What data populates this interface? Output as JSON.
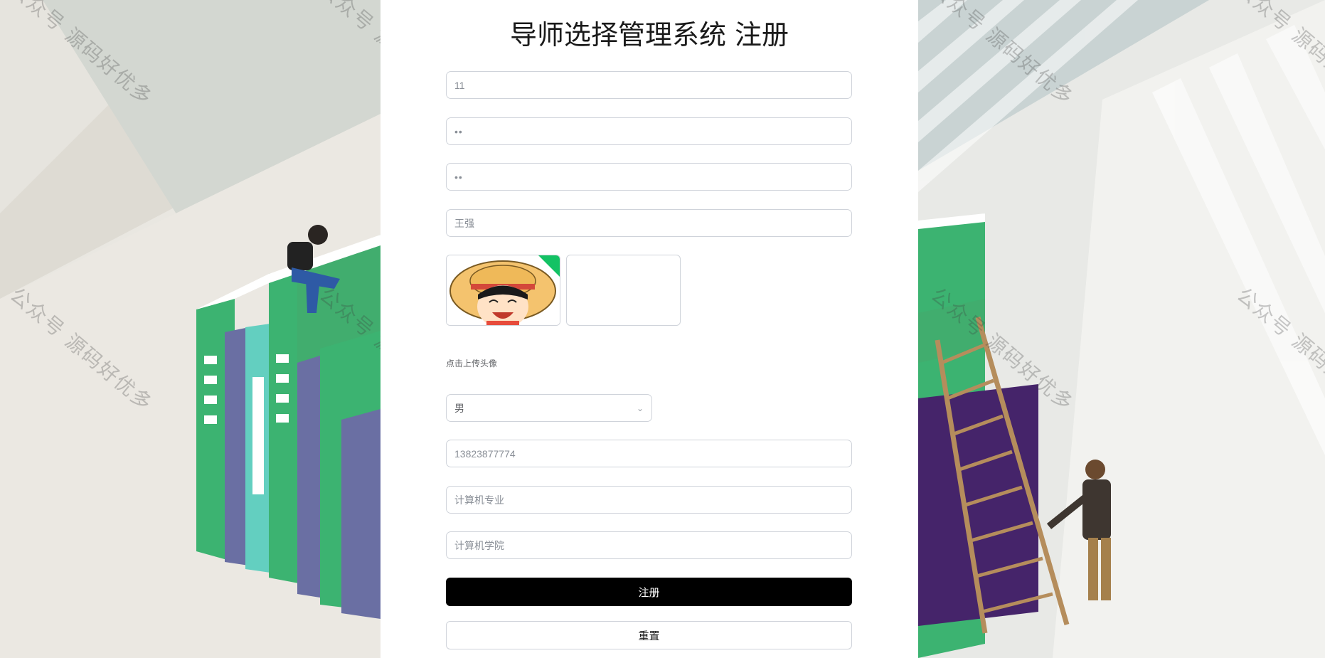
{
  "page": {
    "title": "导师选择管理系统 注册"
  },
  "form": {
    "account": "11",
    "password": "••",
    "password_confirm": "••",
    "name": "王强",
    "upload_hint": "点击上传头像",
    "gender": "男",
    "phone": "13823877774",
    "major": "计算机专业",
    "college": "计算机学院"
  },
  "buttons": {
    "register": "注册",
    "reset": "重置"
  },
  "watermark": "公众号 源码好优多",
  "colors": {
    "primary_button": "#000000",
    "upload_corner": "#13c264",
    "book_green": "#3cb371",
    "book_purple": "#6a6fa3"
  },
  "icons": {
    "select_arrow": "chevron-down-icon",
    "cursor": "hand-pointer-icon",
    "avatar": "straw-hat-cartoon-avatar"
  }
}
